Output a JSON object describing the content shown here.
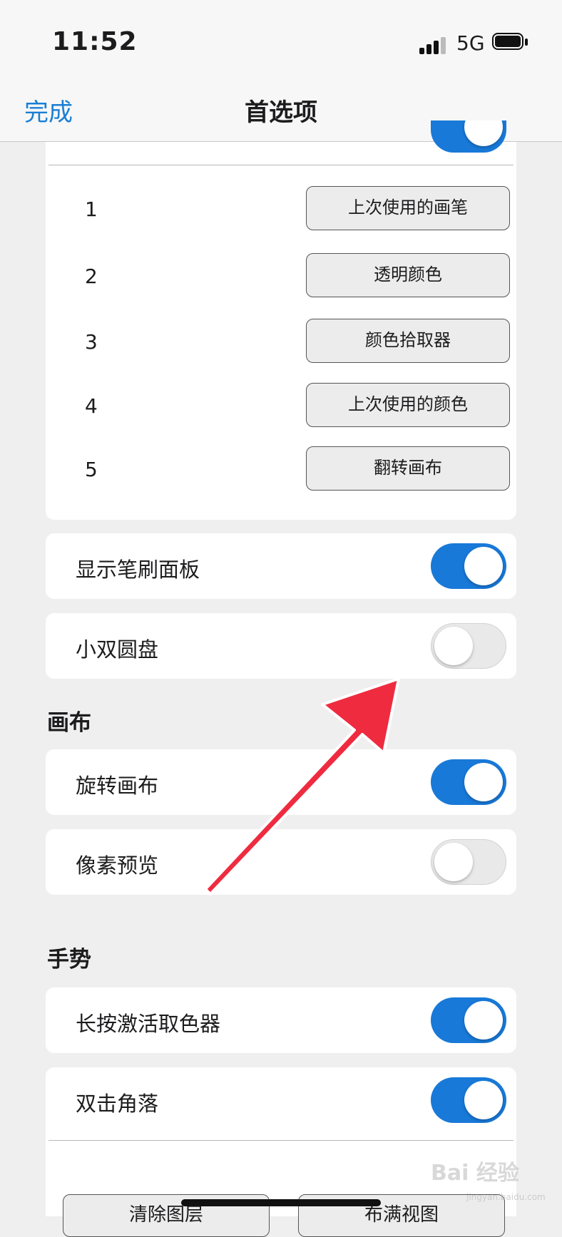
{
  "status": {
    "time": "11:52",
    "network": "5G"
  },
  "nav": {
    "done": "完成",
    "title": "首选项"
  },
  "shortcuts": [
    {
      "num": "1",
      "action": "上次使用的画笔"
    },
    {
      "num": "2",
      "action": "透明颜色"
    },
    {
      "num": "3",
      "action": "颜色拾取器"
    },
    {
      "num": "4",
      "action": "上次使用的颜色"
    },
    {
      "num": "5",
      "action": "翻转画布"
    }
  ],
  "settings": {
    "show_brush_panel": {
      "label": "显示笔刷面板",
      "on": true
    },
    "small_double_dial": {
      "label": "小双圆盘",
      "on": false
    }
  },
  "canvas_section": {
    "title": "画布",
    "rotate_canvas": {
      "label": "旋转画布",
      "on": true
    },
    "pixel_preview": {
      "label": "像素预览",
      "on": false
    }
  },
  "gesture_section": {
    "title": "手势",
    "long_press_picker": {
      "label": "长按激活取色器",
      "on": true
    },
    "double_tap_corner": {
      "label": "双击角落",
      "on": true
    }
  },
  "bottom_buttons": {
    "clear_layer": "清除图层",
    "fit_view": "布满视图"
  },
  "watermark": {
    "text": "Bai 经验",
    "sub": "jingyan.baidu.com"
  },
  "colors": {
    "accent": "#1879d8",
    "arrow": "#ef2b40",
    "background": "#efefef"
  }
}
